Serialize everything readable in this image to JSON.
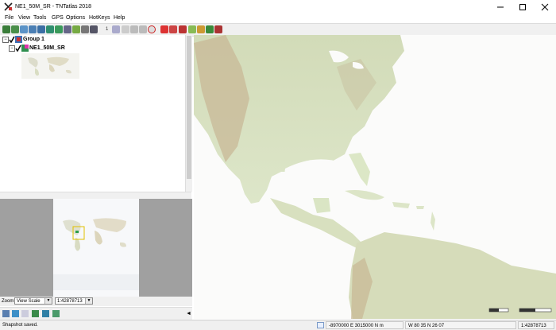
{
  "window": {
    "title": "NE1_50M_SR - TNTatlas 2018",
    "minimize_icon": "minimize-icon",
    "maximize_icon": "maximize-icon",
    "close_icon": "close-icon"
  },
  "menu": {
    "items": [
      "File",
      "View",
      "Tools",
      "GPS",
      "Options",
      "HotKeys",
      "Help"
    ]
  },
  "toolbar": {
    "mode_number": "1"
  },
  "layers": {
    "group_label": "Group 1",
    "layer_label": "NE1_50M_SR"
  },
  "zoom": {
    "label": "Zoom",
    "mode_value": "View Scale",
    "scale_value": "1:42878713"
  },
  "status": {
    "message": "Shapshot saved.",
    "map_coords": "-8970000 E  3015000 N m",
    "latlon": "W 80 35  N 26 07",
    "scale": "1:42878713"
  },
  "colors": {
    "sea": "#fbfbfa",
    "land_low": "#d9e3c4",
    "land_high": "#cdb99a",
    "accent_green": "#2e8b57"
  }
}
